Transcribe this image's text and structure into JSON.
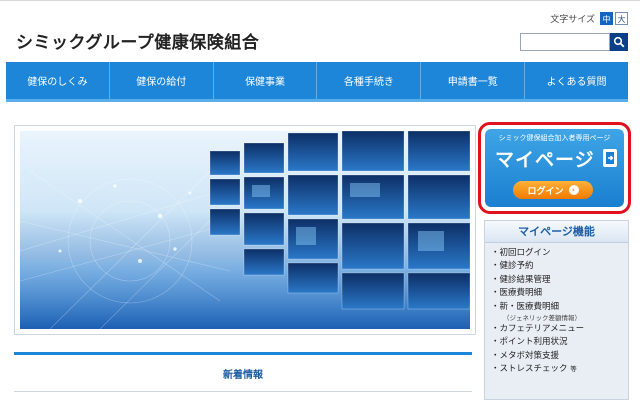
{
  "header": {
    "site_title": "シミックグループ健康保険組合",
    "font_size_label": "文字サイズ",
    "font_sizes": [
      "中",
      "大"
    ],
    "search_placeholder": ""
  },
  "nav": {
    "items": [
      "健保のしくみ",
      "健保の給付",
      "保健事業",
      "各種手続き",
      "申請書一覧",
      "よくある質問"
    ]
  },
  "news": {
    "tab_label": "新着情報"
  },
  "mypage_banner": {
    "subtitle": "シミック健保組合加入者専用ページ",
    "title": "マイページ",
    "login_label": "ログイン",
    "highlight_color": "#e0111d"
  },
  "features": {
    "title": "マイページ機能",
    "items": [
      {
        "label": "初回ログイン"
      },
      {
        "label": "健診予約"
      },
      {
        "label": "健診結果管理"
      },
      {
        "label": "医療費明細"
      },
      {
        "label": "新・医療費明細",
        "note": "（ジェネリック差額情報）"
      },
      {
        "label": "カフェテリアメニュー"
      },
      {
        "label": "ポイント利用状況"
      },
      {
        "label": "メタボ対策支援"
      },
      {
        "label": "ストレスチェック",
        "suffix": "等"
      }
    ]
  },
  "colors": {
    "nav_blue": "#1e86d9",
    "accent_orange": "#f07a00",
    "title_blue": "#1e5fa8"
  }
}
